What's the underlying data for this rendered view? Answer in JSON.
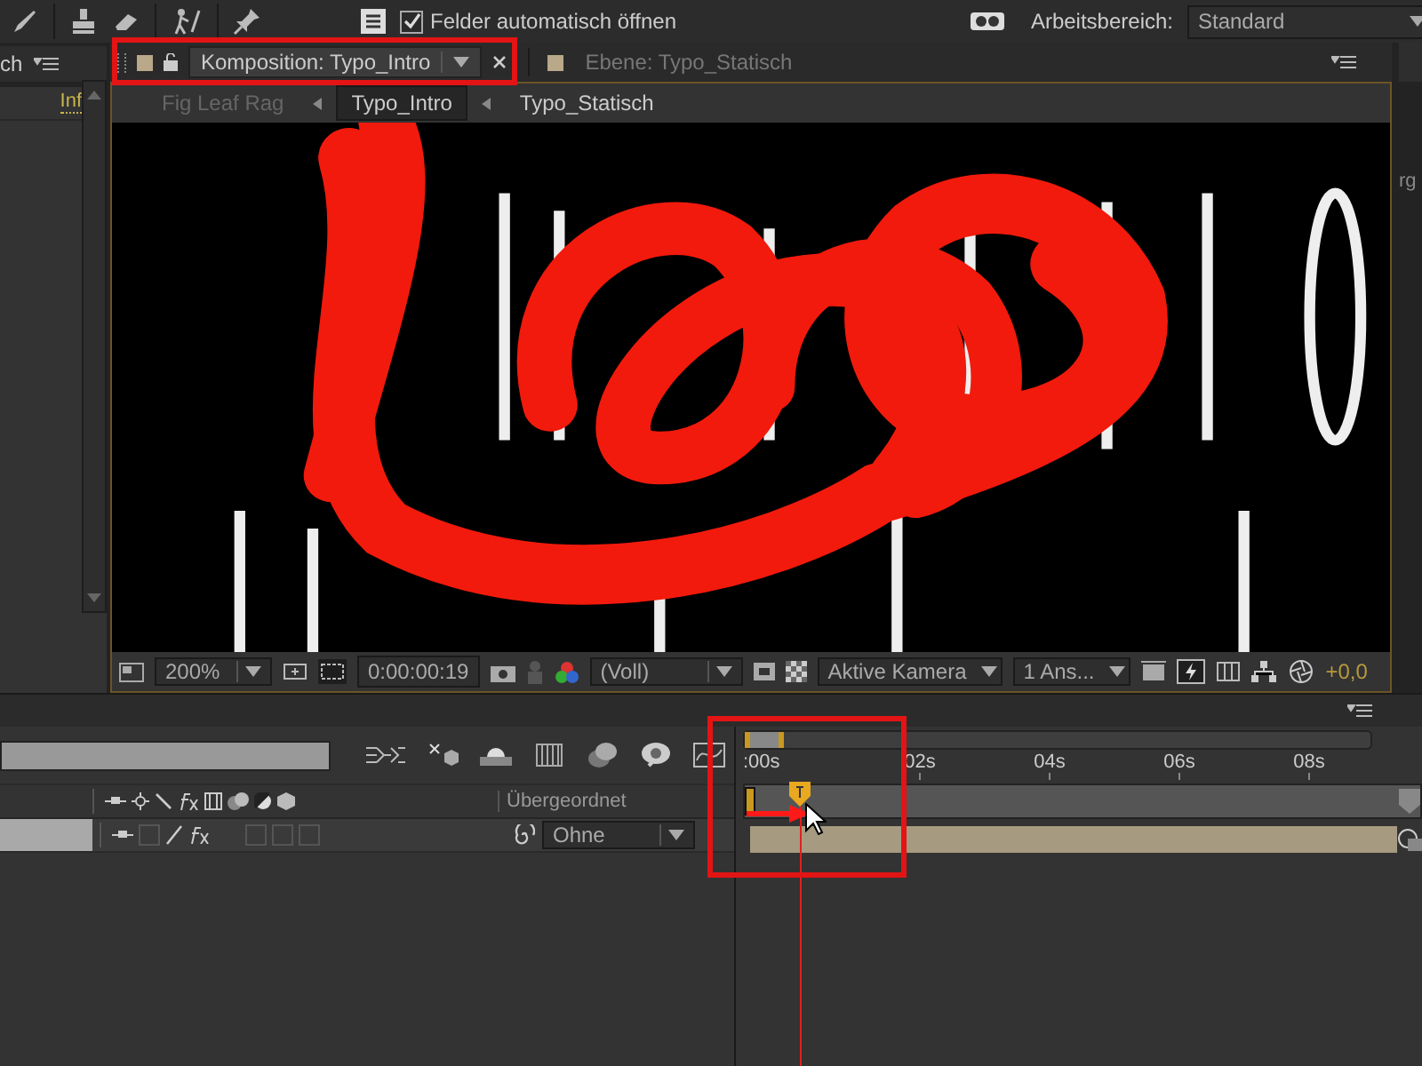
{
  "toolbar": {
    "auto_open": {
      "label": "Felder automatisch öffnen",
      "checked": true
    },
    "workspace": {
      "label": "Arbeitsbereich:",
      "value": "Standard"
    }
  },
  "project_panel": {
    "tab": "ch",
    "column": "Inf"
  },
  "comp_panel": {
    "tabs": [
      {
        "label": "Komposition: Typo_Intro",
        "selected": true
      },
      {
        "label": "Ebene: Typo_Statisch",
        "selected": false
      }
    ],
    "breadcrumbs": [
      {
        "label": "Fig Leaf Rag",
        "selected": false,
        "disabled": true
      },
      {
        "label": "Typo_Intro",
        "selected": true,
        "disabled": false
      },
      {
        "label": "Typo_Statisch",
        "selected": false,
        "disabled": false
      }
    ],
    "viewer_toolbar": {
      "zoom": "200%",
      "timecode": "0:00:00:19",
      "resolution": "(Voll)",
      "camera": "Aktive Kamera",
      "views": "1 Ans...",
      "exposure": "+0,0"
    }
  },
  "right_panel": {
    "label": "rg"
  },
  "timeline": {
    "parent_column": "Übergeordnet",
    "layers": [
      {
        "parent": "Ohne"
      }
    ],
    "ruler": [
      ":00s",
      "02s",
      "04s",
      "06s",
      "08s"
    ]
  }
}
